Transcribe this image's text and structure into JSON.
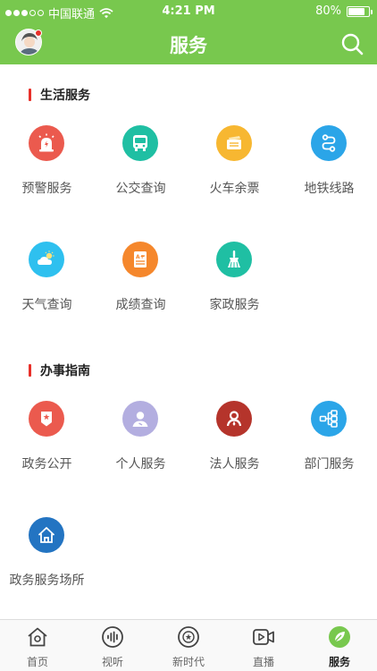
{
  "status_bar": {
    "carrier": "中国联通",
    "time": "4:21 PM",
    "battery_text": "80%",
    "battery_level": 0.8,
    "signal_strength": 3
  },
  "nav": {
    "title": "服务",
    "avatar_icon": "user-avatar-icon",
    "search_icon": "search-icon"
  },
  "life_services": {
    "title": "生活服务",
    "items": [
      {
        "label": "预警服务",
        "icon": "alarm-siren-icon",
        "color": "#eb5a4e"
      },
      {
        "label": "公交查询",
        "icon": "bus-icon",
        "color": "#1fbfa3"
      },
      {
        "label": "火车余票",
        "icon": "train-ticket-icon",
        "color": "#f7b731"
      },
      {
        "label": "地铁线路",
        "icon": "subway-route-icon",
        "color": "#2ba5e8"
      },
      {
        "label": "天气查询",
        "icon": "weather-icon",
        "color": "#2ec0ef"
      },
      {
        "label": "成绩查询",
        "icon": "score-report-icon",
        "color": "#f5872c"
      },
      {
        "label": "家政服务",
        "icon": "broom-icon",
        "color": "#1fbfa3"
      }
    ]
  },
  "guide": {
    "title": "办事指南",
    "items": [
      {
        "label": "政务公开",
        "icon": "government-badge-icon",
        "color": "#eb5a4e"
      },
      {
        "label": "个人服务",
        "icon": "person-icon",
        "color": "#b3aee0"
      },
      {
        "label": "法人服务",
        "icon": "legal-person-icon",
        "color": "#b5342b"
      },
      {
        "label": "部门服务",
        "icon": "org-chart-icon",
        "color": "#2ba5e8"
      },
      {
        "label": "政务服务场所",
        "icon": "home-building-icon",
        "color": "#2374c2"
      }
    ]
  },
  "tab_bar": {
    "active_color": "#78c84e",
    "tabs": [
      {
        "label": "首页",
        "icon": "home-icon"
      },
      {
        "label": "视听",
        "icon": "audio-wave-icon"
      },
      {
        "label": "新时代",
        "icon": "star-circle-icon"
      },
      {
        "label": "直播",
        "icon": "live-video-icon"
      },
      {
        "label": "服务",
        "icon": "leaf-icon",
        "active": true
      }
    ]
  },
  "colors": {
    "theme_green": "#78c84e",
    "section_marker_red": "#e8302a"
  }
}
